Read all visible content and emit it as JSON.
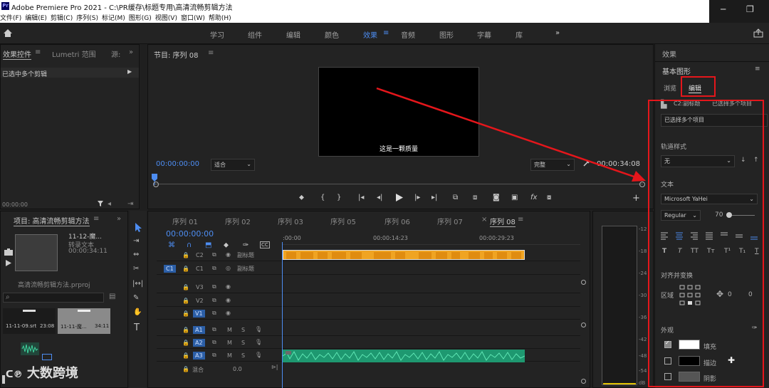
{
  "window": {
    "title": "Adobe Premiere Pro 2021 - C:\\PR缓存\\标题专用\\高清流畅剪辑方法",
    "app_badge": "Pr",
    "controls": [
      "─",
      "❐"
    ]
  },
  "menu": [
    "文件(F)",
    "编辑(E)",
    "剪辑(C)",
    "序列(S)",
    "标记(M)",
    "图形(G)",
    "视图(V)",
    "窗口(W)",
    "帮助(H)"
  ],
  "workspaces": [
    "学习",
    "组件",
    "编辑",
    "颜色",
    "效果",
    "音频",
    "图形",
    "字幕",
    "库"
  ],
  "workspace_active": "效果",
  "workspace_more": "»",
  "effect_controls": {
    "tabs": [
      "效果控件",
      "Lumetri 范围",
      "源:"
    ],
    "message": "已选中多个剪辑",
    "timecode": "00:00:00"
  },
  "program": {
    "tab": "节目: 序列 08",
    "caption": "这是一颗质量",
    "timecode": "00:00:00:00",
    "duration": "00:00:34:08",
    "fit": "适合",
    "quality": "完整"
  },
  "project": {
    "tab": "项目: 高清流畅剪辑方法",
    "clip_name": "11-12-魔...",
    "clip_type": "转录文本",
    "clip_dur": "00:00:34:11",
    "file": "高清流畅剪辑方法.prproj",
    "thumbs": [
      {
        "name": "11-11-09.srt",
        "dur": "23:08"
      },
      {
        "name": "11-11-魔...",
        "dur": "34:11"
      }
    ]
  },
  "timeline": {
    "tabs": [
      "序列 01",
      "序列 02",
      "序列 03",
      "序列 05",
      "序列 06",
      "序列 07",
      "序列 08"
    ],
    "active_tab": "序列 08",
    "timecode": "00:00:00:00",
    "ruler": [
      ":00:00",
      "00:00:14:23",
      "00:00:29:23"
    ],
    "tracks": [
      {
        "id": "C2",
        "name": "副标题"
      },
      {
        "id": "C1",
        "name": "副标题"
      },
      {
        "id": "V3",
        "name": ""
      },
      {
        "id": "V2",
        "name": ""
      },
      {
        "id": "V1",
        "name": ""
      },
      {
        "id": "A1",
        "name": ""
      },
      {
        "id": "A2",
        "name": ""
      },
      {
        "id": "A3",
        "name": ""
      }
    ],
    "mix_label": "混合",
    "mix_value": "0.0",
    "mute": "M",
    "solo": "S"
  },
  "meter": {
    "labels": [
      "-12",
      "-18",
      "-24",
      "-30",
      "-36",
      "-42",
      "-48",
      "-54",
      "dB"
    ]
  },
  "eg": {
    "effects_label": "效果",
    "panel_title": "基本图形",
    "tab_browse": "浏览",
    "tab_edit": "编辑",
    "layer_label": "C2:副标题",
    "layer_extra": "已选择多个项目",
    "selected_items": "已选择多个项目",
    "track_style_label": "轨道样式",
    "track_style_value": "无",
    "text_label": "文本",
    "font": "Microsoft YaHei",
    "weight": "Regular",
    "size": "70",
    "align_label": "对齐并变换",
    "area_label": "区域",
    "pos_x": "0",
    "pos_y": "0",
    "appearance_label": "外观",
    "fill_label": "填充",
    "stroke_label": "描边",
    "shadow_label": "阴影",
    "style_buttons": [
      "T",
      "T",
      "TT",
      "Tт",
      "T¹",
      "T₁",
      "T"
    ]
  },
  "watermark": "大数跨境",
  "colors": {
    "accent": "#4d8df2",
    "highlight": "#e5161b",
    "clip_orange": "#f0a422",
    "audio_green": "#1e9870"
  }
}
